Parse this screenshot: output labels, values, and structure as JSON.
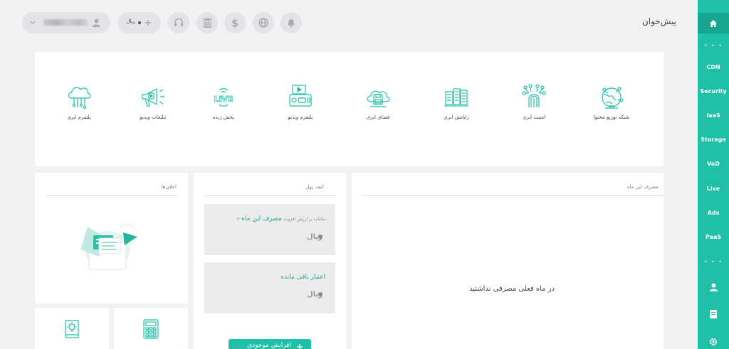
{
  "header": {
    "page_title": "پیش‌خوان",
    "user_name": "‌",
    "currency_pill": "ریال"
  },
  "sidebar": {
    "items": [
      {
        "label": "CDN"
      },
      {
        "label": "Security"
      },
      {
        "label": "IaaS"
      },
      {
        "label": "Storage"
      },
      {
        "label": "VoD"
      },
      {
        "label": "Live"
      },
      {
        "label": "Ads"
      },
      {
        "label": "PaaS"
      }
    ],
    "dots": "• • •"
  },
  "services": [
    {
      "label": "شبکه توزیع محتوا",
      "icon": "globe-network-icon"
    },
    {
      "label": "امنیت ابری",
      "icon": "fingerprint-icon"
    },
    {
      "label": "رایانش ابری",
      "icon": "servers-icon"
    },
    {
      "label": "فضای ابری",
      "icon": "cloud-storage-icon"
    },
    {
      "label": "پلتفرم ویدیو",
      "icon": "video-player-icon"
    },
    {
      "label": "پخش زنده",
      "icon": "live-icon"
    },
    {
      "label": "تبلیغات ویدیو",
      "icon": "megaphone-icon"
    },
    {
      "label": "پلتفرم ابری",
      "icon": "cloud-platform-icon"
    }
  ],
  "usage": {
    "title": "مصرف این ماه",
    "empty_message": "در ماه فعلی مصرفی نداشتید"
  },
  "wallet": {
    "title": "کیف پول",
    "spent_title": "مصرف این ماه",
    "spent_subtitle": "+ مالیات بر ارزش افزوده",
    "spent_currency": "ریال",
    "balance_title": "اعتبار باقی مانده",
    "balance_currency": "ریال",
    "increase_button": "افزایش موجودی"
  },
  "announcements": {
    "title": "اعلان‌ها"
  },
  "colors": {
    "accent": "#20c0a8",
    "sidebar_active": "#15a690",
    "background": "#f2f2f4"
  }
}
